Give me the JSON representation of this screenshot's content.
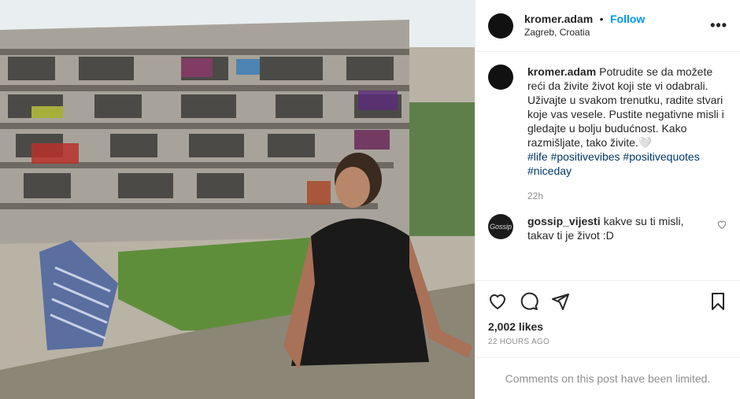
{
  "post": {
    "username": "kromer.adam",
    "separator": "•",
    "follow_label": "Follow",
    "location": "Zagreb, Croatia",
    "more_icon": "more-options-icon"
  },
  "caption": {
    "username": "kromer.adam",
    "text": "Potrudite se da možete reći da živite život koji ste vi odabrali. Uživajte u svakom trenutku, radite stvari koje vas vesele. Pustite negativne misli i gledajte u bolju budućnost. Kako razmišljate, tako živite.🤍",
    "hashtags": [
      "#life",
      "#positivevibes",
      "#positivequotes",
      "#niceday"
    ],
    "time": "22h"
  },
  "comments": [
    {
      "username": "gossip_vijesti",
      "avatar_text": "Gossip",
      "text": "kakve su ti misli, takav ti je život :D"
    }
  ],
  "actions": {
    "icons": [
      "heart-icon",
      "comment-icon",
      "share-icon",
      "bookmark-icon"
    ],
    "likes": "2,002 likes",
    "posted_ago": "22 HOURS AGO"
  },
  "footer": {
    "limited_text": "Comments on this post have been limited."
  },
  "colors": {
    "accent": "#0095f6",
    "text": "#262626",
    "muted": "#8e8e8e",
    "hashtag": "#00376b"
  }
}
